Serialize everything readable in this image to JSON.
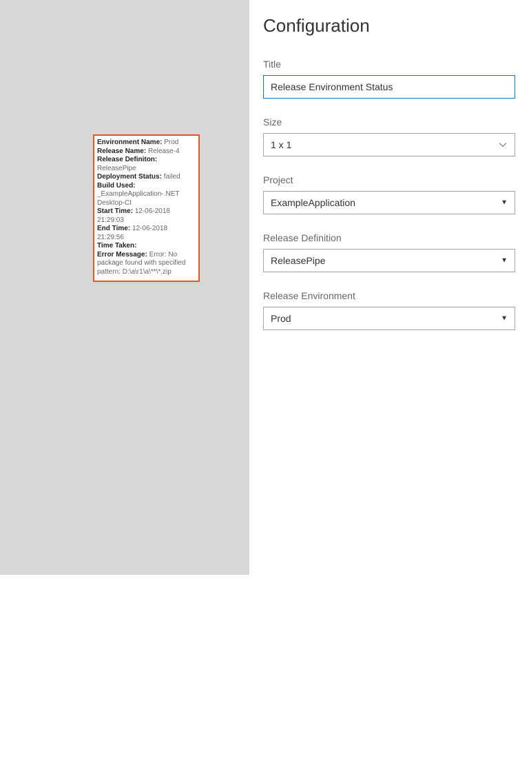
{
  "header": {
    "title": "Configuration"
  },
  "fields": {
    "title_label": "Title",
    "title_value": "Release Environment Status",
    "size_label": "Size",
    "size_value": "1 x 1",
    "project_label": "Project",
    "project_value": "ExampleApplication",
    "releasedef_label": "Release Definition",
    "releasedef_value": "ReleasePipe",
    "releaseenv_label": "Release Environment",
    "releaseenv_value": "Prod"
  },
  "tile": {
    "env_name_label": "Environment Name:",
    "env_name_value": "Prod",
    "release_name_label": "Release Name:",
    "release_name_value": "Release-4",
    "release_def_label": "Release Definiton:",
    "release_def_value": "ReleasePipe",
    "deploy_status_label": "Deployment Status:",
    "deploy_status_value": "failed",
    "build_used_label": "Build Used:",
    "build_used_value": "_ExampleApplication-.NET Desktop-CI",
    "start_time_label": "Start Time:",
    "start_time_value": "12-06-2018 21:29:03",
    "end_time_label": "End Time:",
    "end_time_value": "12-06-2018 21:29:56",
    "time_taken_label": "Time Taken:",
    "time_taken_value": "",
    "error_label": "Error Message:",
    "error_value": "Error: No package found with specified pattern: D:\\a\\r1\\a\\**\\*.zip"
  }
}
